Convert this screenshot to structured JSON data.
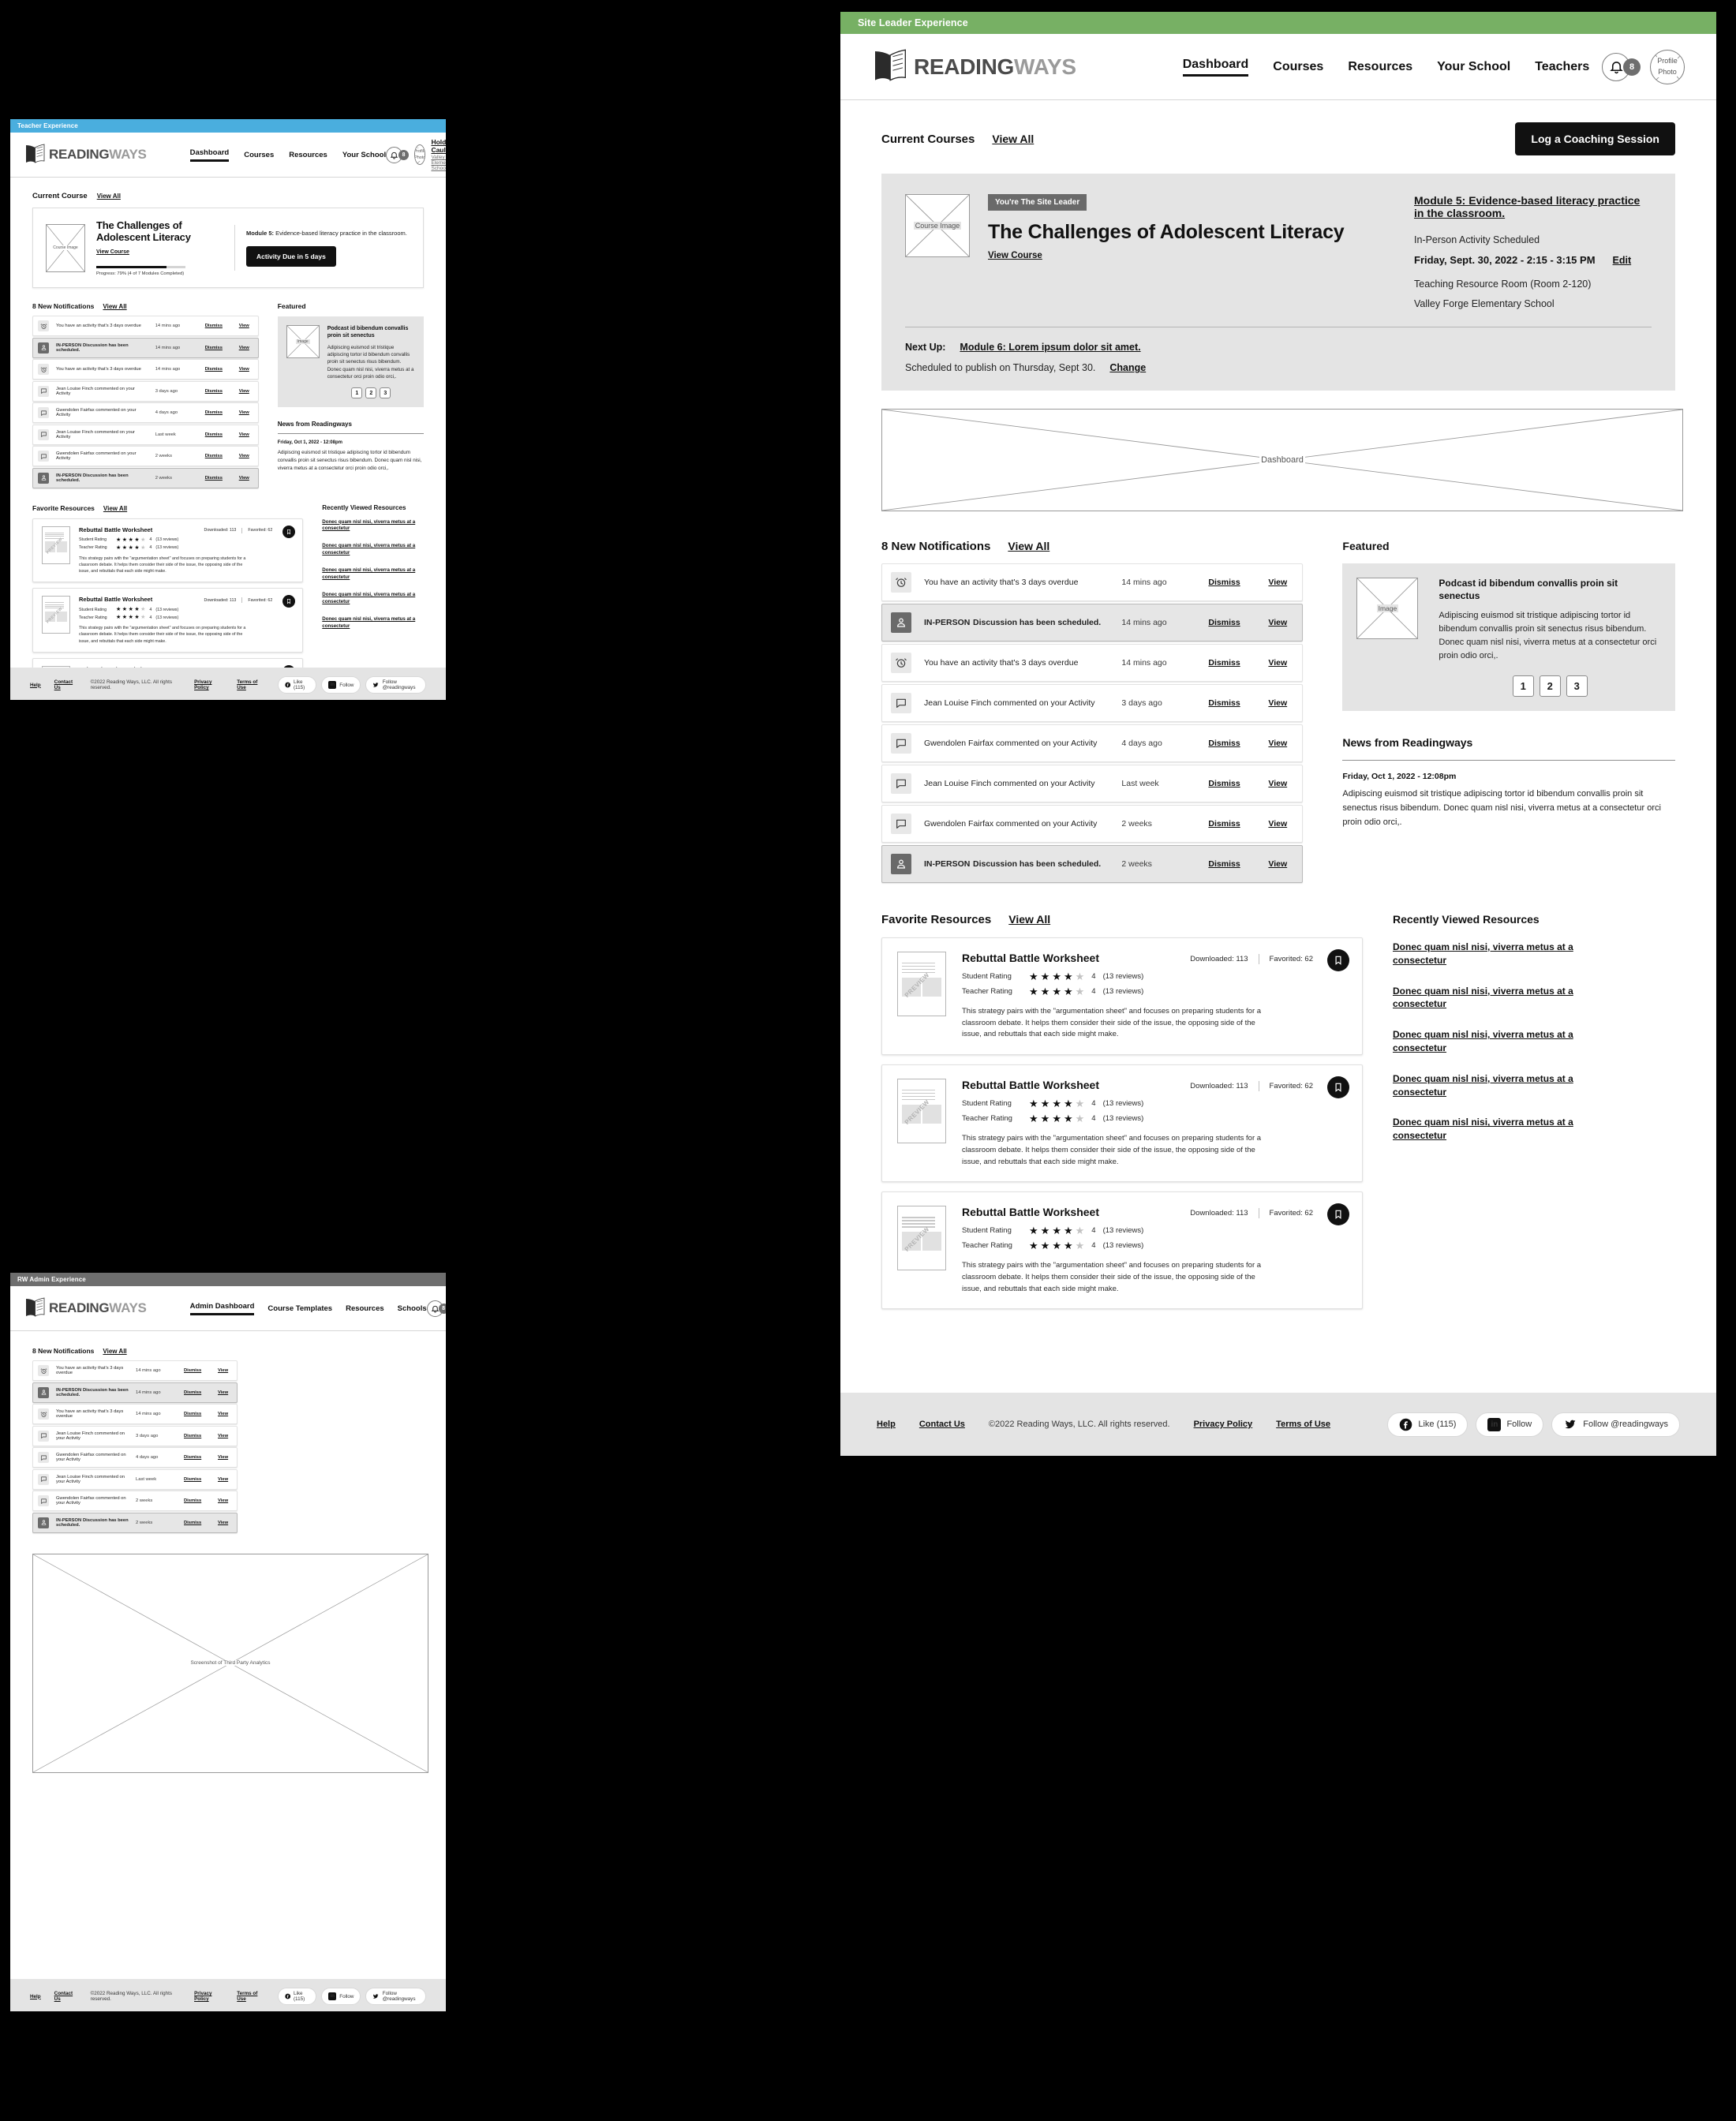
{
  "brand": {
    "dark": "READING",
    "light": "WAYS"
  },
  "common": {
    "notifications_heading": "8 New Notifications",
    "view_all": "View All",
    "dismiss": "Dismiss",
    "view": "View",
    "bell_count": "8",
    "avatar_line1": "Profile",
    "avatar_line2": "Photo",
    "featured_heading": "Featured",
    "featured_title": "Podcast id bibendum convallis proin sit senectus",
    "featured_body": "Adipiscing euismod sit tristique adipiscing tortor id bibendum convallis proin sit senectus risus bibendum. Donec quam nisl nisi, viverra metus at a consectetur orci proin odio orci,.",
    "featured_image_label": "Image",
    "pager": [
      "1",
      "2",
      "3"
    ],
    "news_heading": "News from Readingways",
    "news_date": "Friday, Oct 1, 2022 - 12:08pm",
    "news_body": "Adipiscing euismod sit tristique adipiscing tortor id bibendum convallis proin sit senectus risus bibendum. Donec quam nisl nisi, viverra metus at a consectetur orci proin odio orci,.",
    "favorite_resources_heading": "Favorite Resources",
    "recently_viewed_heading": "Recently Viewed Resources",
    "recently_viewed_links": [
      "Donec quam nisl nisi, viverra metus at a consectetur",
      "Donec quam nisl nisi, viverra metus at a consectetur",
      "Donec quam nisl nisi, viverra metus at a consectetur",
      "Donec quam nisl nisi, viverra metus at a consectetur",
      "Donec quam nisl nisi, viverra metus at a consectetur"
    ],
    "resource": {
      "title": "Rebuttal Battle Worksheet",
      "student_rating_label": "Student Rating",
      "teacher_rating_label": "Teacher Rating",
      "rating_value": "4",
      "reviews": "(13 reviews)",
      "stars_filled": 4,
      "stars_total": 5,
      "downloaded": "Downloaded: 113",
      "favorited": "Favorited: 62",
      "description": "This strategy pairs with the \"argumentation sheet\" and focuses on preparing students for a classroom debate. It helps them consider their side of the issue, the opposing side of the issue, and rebuttals that each side might make.",
      "thumb_watermark": "PREVIEW"
    },
    "notifications": [
      {
        "icon": "alarm-clock-icon",
        "type": "normal",
        "tag": "",
        "text": "You have an activity that's 3 days overdue",
        "time": "14 mins ago"
      },
      {
        "icon": "person-icon",
        "type": "inperson",
        "tag": "IN-PERSON",
        "text": "Discussion has been scheduled.",
        "time": "14 mins ago"
      },
      {
        "icon": "alarm-clock-icon",
        "type": "normal",
        "tag": "",
        "text": "You have an activity that's 3 days overdue",
        "time": "14 mins ago"
      },
      {
        "icon": "comment-icon",
        "type": "normal",
        "tag": "",
        "text": "Jean Louise Finch commented on your Activity",
        "time": "3 days ago"
      },
      {
        "icon": "comment-icon",
        "type": "normal",
        "tag": "",
        "text": "Gwendolen Fairfax commented on your Activity",
        "time": "4 days ago"
      },
      {
        "icon": "comment-icon",
        "type": "normal",
        "tag": "",
        "text": "Jean Louise Finch commented on your Activity",
        "time": "Last week"
      },
      {
        "icon": "comment-icon",
        "type": "normal",
        "tag": "",
        "text": "Gwendolen Fairfax commented on your Activity",
        "time": "2 weeks"
      },
      {
        "icon": "person-icon",
        "type": "inperson",
        "tag": "IN-PERSON",
        "text": "Discussion has been scheduled.",
        "time": "2 weeks"
      }
    ],
    "footer": {
      "help": "Help",
      "contact": "Contact Us",
      "copyright": "©2022 Reading Ways, LLC. All rights reserved.",
      "privacy": "Privacy Policy",
      "terms": "Terms of Use",
      "facebook": "Like (115)",
      "linkedin": "Follow",
      "twitter": "Follow @readingways"
    }
  },
  "teacher": {
    "bar_label": "Teacher Experience",
    "bar_color": "#4aaede",
    "nav": [
      "Dashboard",
      "Courses",
      "Resources",
      "Your School"
    ],
    "active_nav": "Dashboard",
    "user_name": "Holden Caulfield",
    "user_school": "Valley Forge Elementary School",
    "current_course_heading": "Current Course",
    "course_image_label": "Course Image",
    "course_title": "The Challenges of Adolescent Literacy",
    "view_course": "View Course",
    "progress_text": "Progress: 79%  (4 of 7 Modules Completed)",
    "progress_pct": 79,
    "module_label": "Module 5:",
    "module_text": " Evidence-based literacy practice in the classroom.",
    "activity_button": "Activity Due in 5 days"
  },
  "admin": {
    "bar_label": "RW Admin Experience",
    "bar_color": "#6e6e6e",
    "nav": [
      "Admin Dashboard",
      "Course Templates",
      "Resources",
      "Schools"
    ],
    "active_nav": "Admin Dashboard",
    "analytics_placeholder": "Screenshot of Third Party Analytics"
  },
  "siteleader": {
    "bar_label": "Site Leader Experience",
    "bar_color": "#77b064",
    "nav": [
      "Dashboard",
      "Courses",
      "Resources",
      "Your School",
      "Teachers"
    ],
    "active_nav": "Dashboard",
    "current_courses_heading": "Current Courses",
    "log_session_button": "Log a Coaching Session",
    "course_image_label": "Course Image",
    "site_leader_chip": "You're The Site Leader",
    "course_title": "The Challenges of Adolescent Literacy",
    "view_course": "View Course",
    "module_link": "Module 5: Evidence-based literacy practice in the classroom.",
    "activity_scheduled": "In-Person Activity Scheduled",
    "activity_datetime": "Friday, Sept. 30, 2022   -   2:15 - 3:15 PM",
    "edit_link": "Edit",
    "room": "Teaching Resource Room (Room 2-120)",
    "school": "Valley Forge Elementary School",
    "next_up_label": "Next Up:",
    "next_up_module": "Module 6: Lorem ipsum dolor sit amet.",
    "publish_text": "Scheduled to publish on Thursday, Sept 30.",
    "change_link": "Change",
    "dashboard_placeholder": "Dashboard"
  }
}
